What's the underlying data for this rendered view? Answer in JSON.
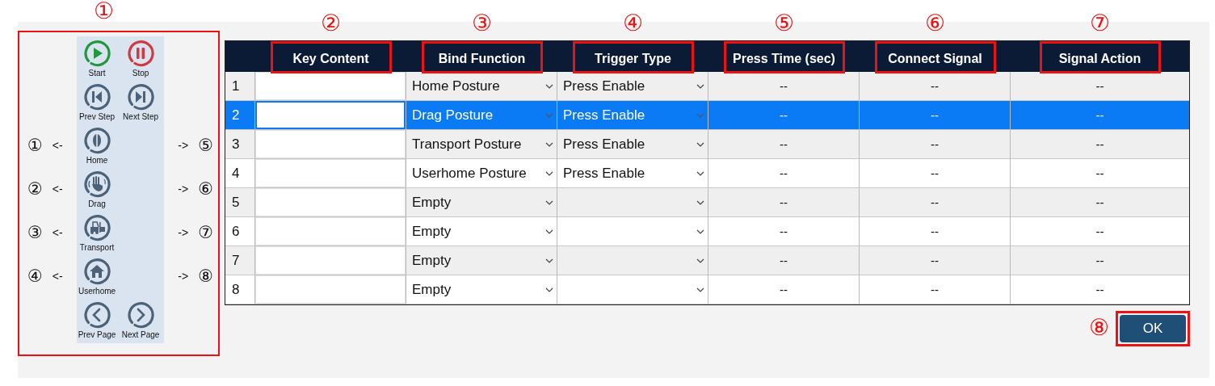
{
  "panel": {
    "annotation": "①",
    "rows": [
      {
        "buttons": [
          {
            "kind": "start",
            "label": "Start"
          },
          {
            "kind": "stop",
            "label": "Stop"
          }
        ]
      },
      {
        "buttons": [
          {
            "kind": "prev_step",
            "label": "Prev Step"
          },
          {
            "kind": "next_step",
            "label": "Next Step"
          }
        ]
      },
      {
        "left_number": "①",
        "left_arrow": "<-",
        "buttons": [
          {
            "kind": "home",
            "label": "Home"
          }
        ],
        "right_arrow": "->",
        "right_number": "⑤"
      },
      {
        "left_number": "②",
        "left_arrow": "<-",
        "buttons": [
          {
            "kind": "drag",
            "label": "Drag"
          }
        ],
        "right_arrow": "->",
        "right_number": "⑥"
      },
      {
        "left_number": "③",
        "left_arrow": "<-",
        "buttons": [
          {
            "kind": "transport",
            "label": "Transport"
          }
        ],
        "right_arrow": "->",
        "right_number": "⑦"
      },
      {
        "left_number": "④",
        "left_arrow": "<-",
        "buttons": [
          {
            "kind": "userhome",
            "label": "Userhome"
          }
        ],
        "right_arrow": "->",
        "right_number": "⑧"
      },
      {
        "buttons": [
          {
            "kind": "prev_page",
            "label": "Prev Page"
          },
          {
            "kind": "next_page",
            "label": "Next Page"
          }
        ]
      }
    ]
  },
  "table": {
    "columns": [
      {
        "label": "Key Content",
        "annotation": "②"
      },
      {
        "label": "Bind Function",
        "annotation": "③"
      },
      {
        "label": "Trigger Type",
        "annotation": "④"
      },
      {
        "label": "Press Time (sec)",
        "annotation": "⑤"
      },
      {
        "label": "Connect Signal",
        "annotation": "⑥"
      },
      {
        "label": "Signal Action",
        "annotation": "⑦"
      }
    ],
    "rows": [
      {
        "number": "1",
        "bind_function": "Home Posture",
        "trigger_type": "Press Enable",
        "press_time": "--",
        "connect_signal": "--",
        "signal_action": "--",
        "selected": false
      },
      {
        "number": "2",
        "bind_function": "Drag Posture",
        "trigger_type": "Press Enable",
        "press_time": "--",
        "connect_signal": "--",
        "signal_action": "--",
        "selected": true
      },
      {
        "number": "3",
        "bind_function": "Transport Posture",
        "trigger_type": "Press Enable",
        "press_time": "--",
        "connect_signal": "--",
        "signal_action": "--",
        "selected": false
      },
      {
        "number": "4",
        "bind_function": "Userhome Posture",
        "trigger_type": "Press Enable",
        "press_time": "--",
        "connect_signal": "--",
        "signal_action": "--",
        "selected": false
      },
      {
        "number": "5",
        "bind_function": "Empty",
        "press_time": "--",
        "connect_signal": "--",
        "signal_action": "--",
        "selected": false
      },
      {
        "number": "6",
        "bind_function": "Empty",
        "press_time": "--",
        "connect_signal": "--",
        "signal_action": "--",
        "selected": false
      },
      {
        "number": "7",
        "bind_function": "Empty",
        "press_time": "--",
        "connect_signal": "--",
        "signal_action": "--",
        "selected": false
      },
      {
        "number": "8",
        "bind_function": "Empty",
        "press_time": "--",
        "connect_signal": "--",
        "signal_action": "--",
        "selected": false
      }
    ]
  },
  "ok_button": {
    "label": "OK",
    "annotation": "⑧"
  }
}
